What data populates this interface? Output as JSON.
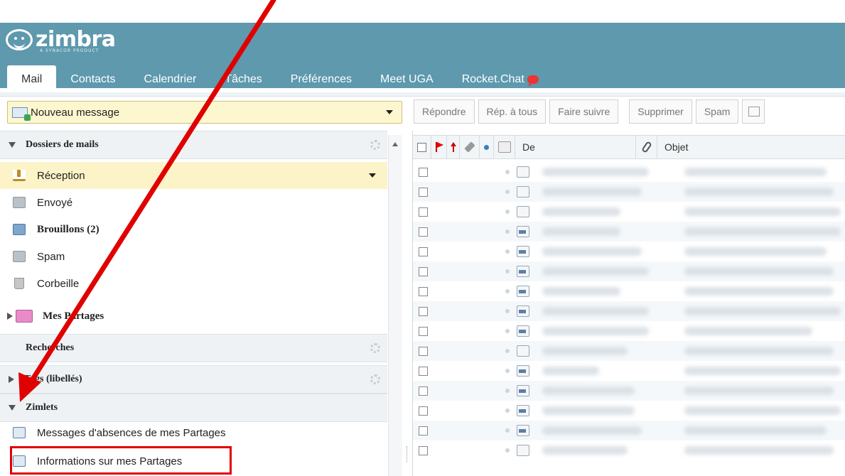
{
  "app": {
    "logo_text": "zimbra",
    "logo_subtitle": "A SYNACOR PRODUCT"
  },
  "tabs": [
    {
      "label": "Mail",
      "active": true
    },
    {
      "label": "Contacts"
    },
    {
      "label": "Calendrier"
    },
    {
      "label": "Tâches"
    },
    {
      "label": "Préférences"
    },
    {
      "label": "Meet UGA"
    },
    {
      "label": "Rocket.Chat"
    }
  ],
  "new_message": {
    "label": "Nouveau message"
  },
  "toolbar": {
    "reply": "Répondre",
    "reply_all": "Rép. à tous",
    "forward": "Faire suivre",
    "delete": "Supprimer",
    "spam": "Spam"
  },
  "sidebar": {
    "mail_folders_header": "Dossiers de mails",
    "folders": [
      {
        "label": "Réception",
        "icon": "inbox-icon",
        "selected": true
      },
      {
        "label": "Envoyé",
        "icon": "sent-icon"
      },
      {
        "label": "Brouillons (2)",
        "icon": "drafts-icon",
        "bold": true
      },
      {
        "label": "Spam",
        "icon": "spam-icon"
      },
      {
        "label": "Corbeille",
        "icon": "trash-icon"
      },
      {
        "label": "Mes Partages",
        "icon": "shared-folder-icon",
        "bold": true
      }
    ],
    "searches_header": "Recherches",
    "tags_header": "Tags (libellés)",
    "zimlets_header": "Zimlets",
    "zimlets": [
      {
        "label": "Messages d'absences de mes Partages",
        "icon": "out-of-office-icon"
      },
      {
        "label": "Informations sur mes Partages",
        "icon": "share-info-icon"
      }
    ]
  },
  "message_list": {
    "columns": {
      "from": "De",
      "subject": "Objet"
    },
    "row_count": 15
  },
  "colors": {
    "header": "#5e99ad",
    "selected_folder": "#fcf4c8",
    "annotation": "#e00000"
  }
}
